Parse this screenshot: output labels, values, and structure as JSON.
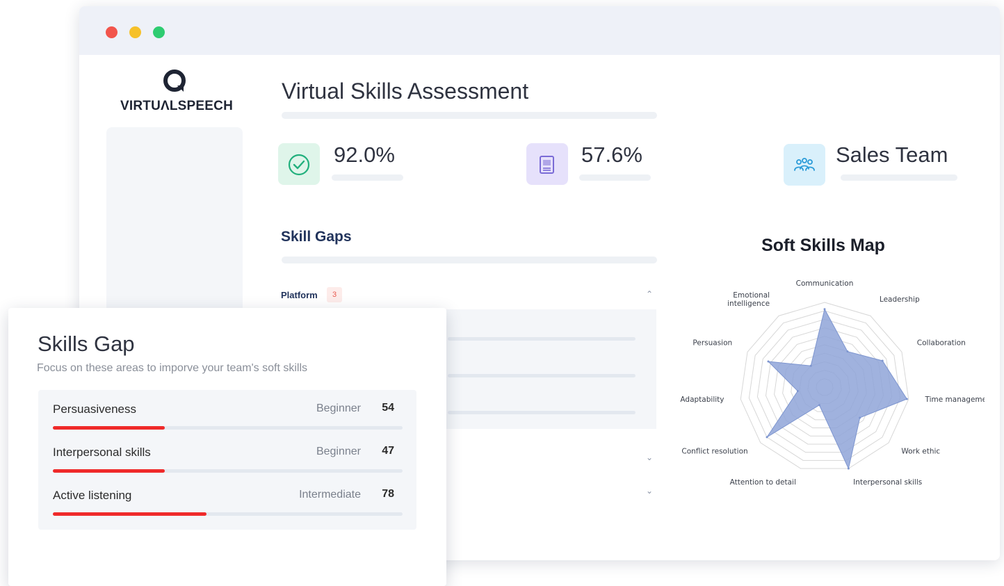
{
  "brand": {
    "name": "VIRTUΛLSPEECH"
  },
  "window": {
    "dot_colors": [
      "#f2554c",
      "#f6c12a",
      "#2ecc71"
    ]
  },
  "header": {
    "title": "Virtual Skills Assessment"
  },
  "stats": [
    {
      "value": "92.0%",
      "icon": "check-circle-icon",
      "color": "#22b07d",
      "bg": "#dff5ea"
    },
    {
      "value": "57.6%",
      "icon": "book-chart-icon",
      "color": "#7a6bd6",
      "bg": "#e6e1fb"
    },
    {
      "value": "Sales Team",
      "icon": "team-icon",
      "color": "#2a9bd8",
      "bg": "#d9f0fb"
    }
  ],
  "skill_gaps": {
    "title": "Skill Gaps",
    "category": "Platform",
    "badge": "3"
  },
  "chart_data": {
    "type": "radar",
    "title": "Soft Skills Map",
    "axes": [
      "Communication",
      "Leadership",
      "Collaboration",
      "Time management",
      "Work ethic",
      "Interpersonal skills",
      "Attention to detail",
      "Conflict resolution",
      "Adaptability",
      "Persuasion",
      "Emotional intelligence"
    ],
    "axis_label_lines": [
      [
        "Communication"
      ],
      [
        "Leadership"
      ],
      [
        "Collaboration"
      ],
      [
        "Time management"
      ],
      [
        "Work ethic"
      ],
      [
        "Interpersonal skills"
      ],
      [
        "Attention to detail"
      ],
      [
        "Conflict resolution"
      ],
      [
        "Adaptability"
      ],
      [
        "Persuasion"
      ],
      [
        "Emotional",
        "intelligence"
      ]
    ],
    "values": [
      92,
      50,
      75,
      98,
      55,
      100,
      22,
      90,
      32,
      73,
      30
    ],
    "max": 100,
    "rings": 10,
    "fill_color": "#8fa5d8",
    "grid_color": "#d7d7d7"
  },
  "skills_gap_card": {
    "title": "Skills Gap",
    "subtitle": "Focus on these areas to imporve your team's soft skills",
    "fill_color": "#ef2a2a",
    "rows": [
      {
        "name": "Persuasiveness",
        "level": "Beginner",
        "score": "54",
        "progress": 0.32
      },
      {
        "name": "Interpersonal skills",
        "level": "Beginner",
        "score": "47",
        "progress": 0.32
      },
      {
        "name": "Active listening",
        "level": "Intermediate",
        "score": "78",
        "progress": 0.44
      }
    ]
  }
}
